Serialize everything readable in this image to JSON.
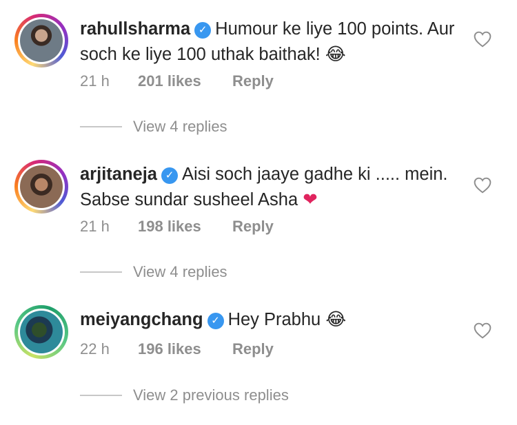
{
  "comments": [
    {
      "username": "rahullsharma",
      "text": "Humour ke liye 100 points. Aur soch ke liye 100 uthak baithak! ",
      "emoji": "😂",
      "time": "21 h",
      "likes": "201 likes",
      "reply_label": "Reply",
      "view_replies": "View 4 replies"
    },
    {
      "username": "arjitaneja",
      "text": "Aisi soch jaaye gadhe ki ..... mein. Sabse sundar susheel Asha ",
      "emoji": "❤",
      "time": "21 h",
      "likes": "198 likes",
      "reply_label": "Reply",
      "view_replies": "View 4 replies"
    },
    {
      "username": "meiyangchang",
      "text": "Hey Prabhu ",
      "emoji": "😂",
      "time": "22 h",
      "likes": "196 likes",
      "reply_label": "Reply",
      "view_replies": "View 2 previous replies"
    }
  ],
  "icons": {
    "verified": "verified-badge-icon",
    "like": "heart-outline-icon"
  },
  "colors": {
    "verified": "#3897f0",
    "muted_text": "#8e8e8e",
    "emoji_heart": "#e0245e"
  }
}
